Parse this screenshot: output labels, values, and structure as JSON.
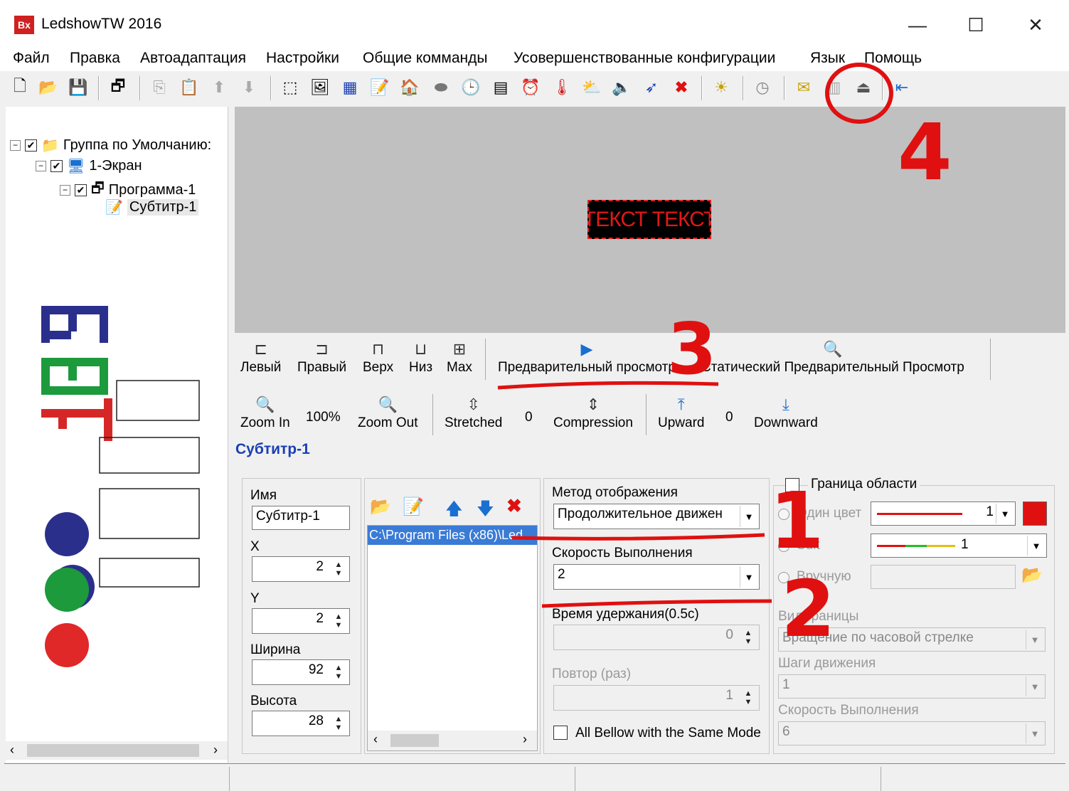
{
  "window": {
    "title": "LedshowTW 2016",
    "logo_text": "Bx"
  },
  "menu": [
    "Файл",
    "Правка",
    "Автоадаптация",
    "Настройки",
    "Общие комманды",
    "Усовершенствованные конфигурации",
    "Язык",
    "Помощь"
  ],
  "tree": {
    "group": "Группа по Умолчанию:",
    "screen": "1-Экран",
    "program": "Программа-1",
    "subtitle": "Субтитр-1"
  },
  "preview": {
    "led_text": "ТЕКСТ ТЕКСТ"
  },
  "align_toolbar": {
    "left": "Левый",
    "right": "Правый",
    "top": "Верх",
    "bottom": "Низ",
    "max": "Max",
    "preview": "Предварительный просмотр",
    "static_preview": "Статический Предварительный Просмотр"
  },
  "zoom_toolbar": {
    "zoom_in": "Zoom In",
    "zoom_value": "100%",
    "zoom_out": "Zoom Out",
    "stretched": "Stretched",
    "stretched_value": "0",
    "compression": "Compression",
    "upward": "Upward",
    "upward_value": "0",
    "downward": "Downward"
  },
  "object_title": "Субтитр-1",
  "props": {
    "name_label": "Имя",
    "name_value": "Субтитр-1",
    "x_label": "X",
    "x_value": "2",
    "y_label": "Y",
    "y_value": "2",
    "width_label": "Ширина",
    "width_value": "92",
    "height_label": "Высота",
    "height_value": "28"
  },
  "file_list": {
    "path": "C:\\Program Files (x86)\\Led"
  },
  "display": {
    "method_label": "Метод отображения",
    "method_value": "Продолжительное движен",
    "speed_label": "Скорость Выполнения",
    "speed_value": "2",
    "hold_label": "Время удержания(0.5с)",
    "hold_value": "0",
    "repeat_label": "Повтор (раз)",
    "repeat_value": "1",
    "same_mode_label": "All Bellow with the Same Mode"
  },
  "border": {
    "title": "Граница области",
    "one_color": "Один цвет",
    "one_color_value": "1",
    "suit": "Suit",
    "suit_value": "1",
    "manual": "Вручную",
    "type_label": "Вид границы",
    "type_value": "Вращение по часовой стрелке",
    "steps_label": "Шаги движения",
    "steps_value": "1",
    "speed_label": "Скорость Выполнения",
    "speed_value": "6"
  },
  "annotations": {
    "n1": "1",
    "n2": "2",
    "n3": "3",
    "n4": "4"
  },
  "colors": {
    "accent_title": "#1a3fb5",
    "led_red": "#e01818",
    "annotation_red": "#e01010"
  }
}
